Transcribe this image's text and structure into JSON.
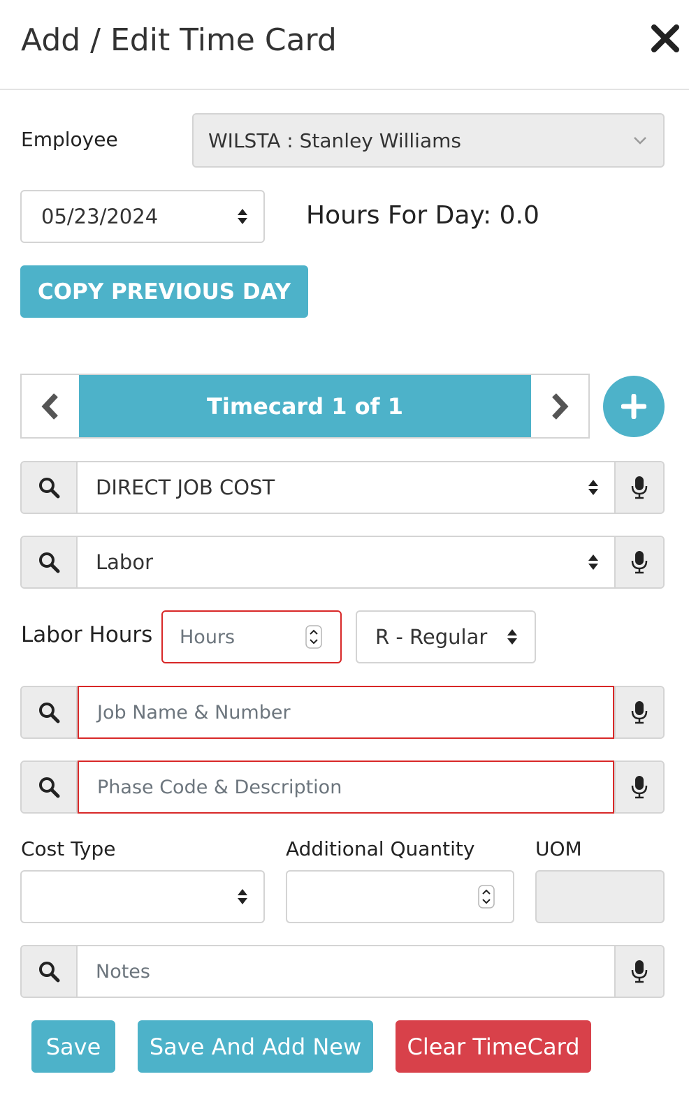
{
  "header": {
    "title": "Add / Edit Time Card"
  },
  "employee": {
    "label": "Employee",
    "value": "WILSTA : Stanley Williams"
  },
  "date": {
    "value": "05/23/2024"
  },
  "hours_for_day": "Hours For Day: 0.0",
  "copy_button": "COPY PREVIOUS DAY",
  "pager": {
    "label": "Timecard 1 of 1"
  },
  "category_select": {
    "value": "DIRECT JOB COST"
  },
  "type_select": {
    "value": "Labor"
  },
  "labor_hours": {
    "label": "Labor Hours",
    "placeholder": "Hours",
    "pay_type": "R - Regular"
  },
  "job": {
    "placeholder": "Job Name & Number"
  },
  "phase": {
    "placeholder": "Phase Code & Description"
  },
  "cost_type": {
    "label": "Cost Type",
    "value": ""
  },
  "additional_quantity": {
    "label": "Additional Quantity",
    "value": ""
  },
  "uom": {
    "label": "UOM",
    "value": ""
  },
  "notes": {
    "placeholder": "Notes"
  },
  "buttons": {
    "save": "Save",
    "save_add_new": "Save And Add New",
    "clear": "Clear TimeCard"
  },
  "colors": {
    "accent": "#4db2c9",
    "danger": "#d8414a",
    "error_border": "#d82828",
    "addon_bg": "#ececec"
  }
}
